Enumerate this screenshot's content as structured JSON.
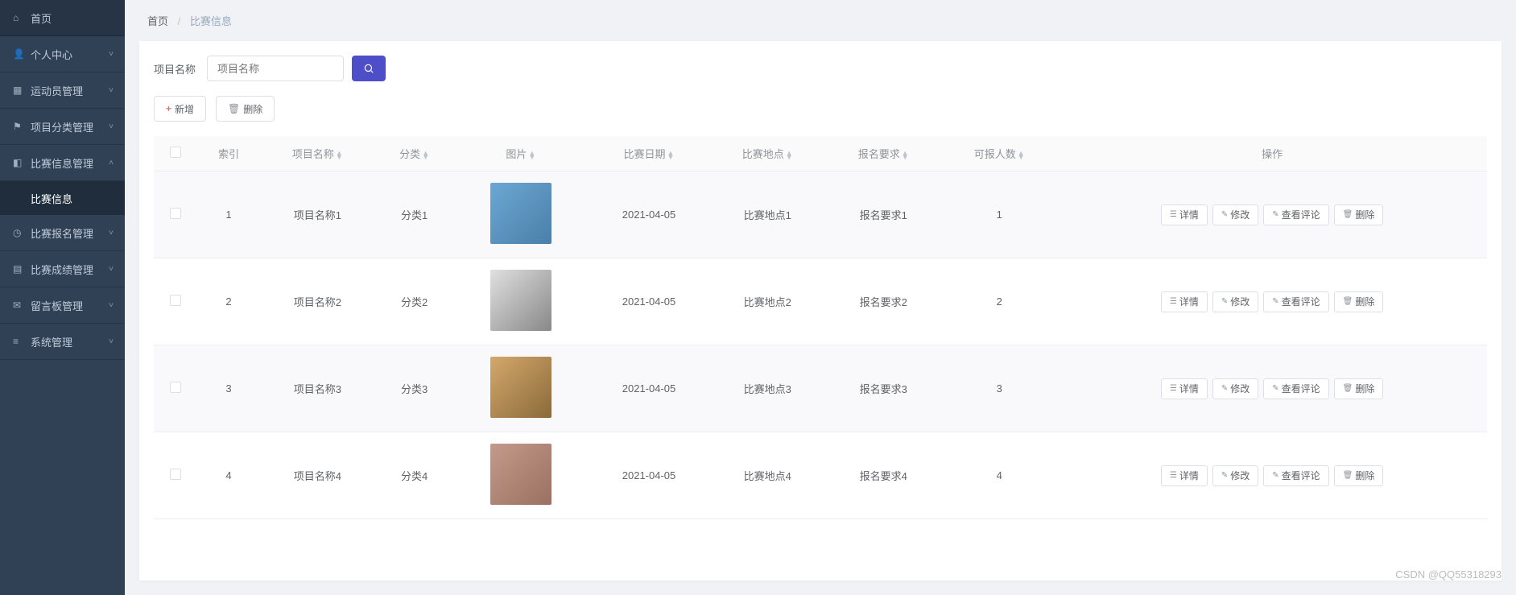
{
  "sidebar": {
    "items": [
      {
        "icon": "⌂",
        "label": "首页",
        "arrow": ""
      },
      {
        "icon": "👤",
        "label": "个人中心",
        "arrow": "˅"
      },
      {
        "icon": "▦",
        "label": "运动员管理",
        "arrow": "˅"
      },
      {
        "icon": "⚑",
        "label": "项目分类管理",
        "arrow": "˅"
      },
      {
        "icon": "◧",
        "label": "比赛信息管理",
        "arrow": "˄",
        "expanded": true
      },
      {
        "icon": "◷",
        "label": "比赛报名管理",
        "arrow": "˅"
      },
      {
        "icon": "▤",
        "label": "比赛成绩管理",
        "arrow": "˅"
      },
      {
        "icon": "✉",
        "label": "留言板管理",
        "arrow": "˅"
      },
      {
        "icon": "≡",
        "label": "系统管理",
        "arrow": "˅"
      }
    ],
    "sub_item": "比赛信息"
  },
  "breadcrumb": {
    "home": "首页",
    "current": "比赛信息"
  },
  "search": {
    "label": "项目名称",
    "placeholder": "项目名称"
  },
  "actions": {
    "add": "新增",
    "delete": "删除"
  },
  "table": {
    "headers": [
      "索引",
      "项目名称",
      "分类",
      "图片",
      "比赛日期",
      "比赛地点",
      "报名要求",
      "可报人数",
      "操作"
    ],
    "rows": [
      {
        "idx": "1",
        "name": "项目名称1",
        "cat": "分类1",
        "date": "2021-04-05",
        "loc": "比赛地点1",
        "req": "报名要求1",
        "cap": "1"
      },
      {
        "idx": "2",
        "name": "项目名称2",
        "cat": "分类2",
        "date": "2021-04-05",
        "loc": "比赛地点2",
        "req": "报名要求2",
        "cap": "2"
      },
      {
        "idx": "3",
        "name": "项目名称3",
        "cat": "分类3",
        "date": "2021-04-05",
        "loc": "比赛地点3",
        "req": "报名要求3",
        "cap": "3"
      },
      {
        "idx": "4",
        "name": "项目名称4",
        "cat": "分类4",
        "date": "2021-04-05",
        "loc": "比赛地点4",
        "req": "报名要求4",
        "cap": "4"
      }
    ],
    "ops": {
      "detail": "详情",
      "edit": "修改",
      "comments": "查看评论",
      "delete": "删除"
    }
  },
  "watermark": "CSDN @QQ55318293"
}
